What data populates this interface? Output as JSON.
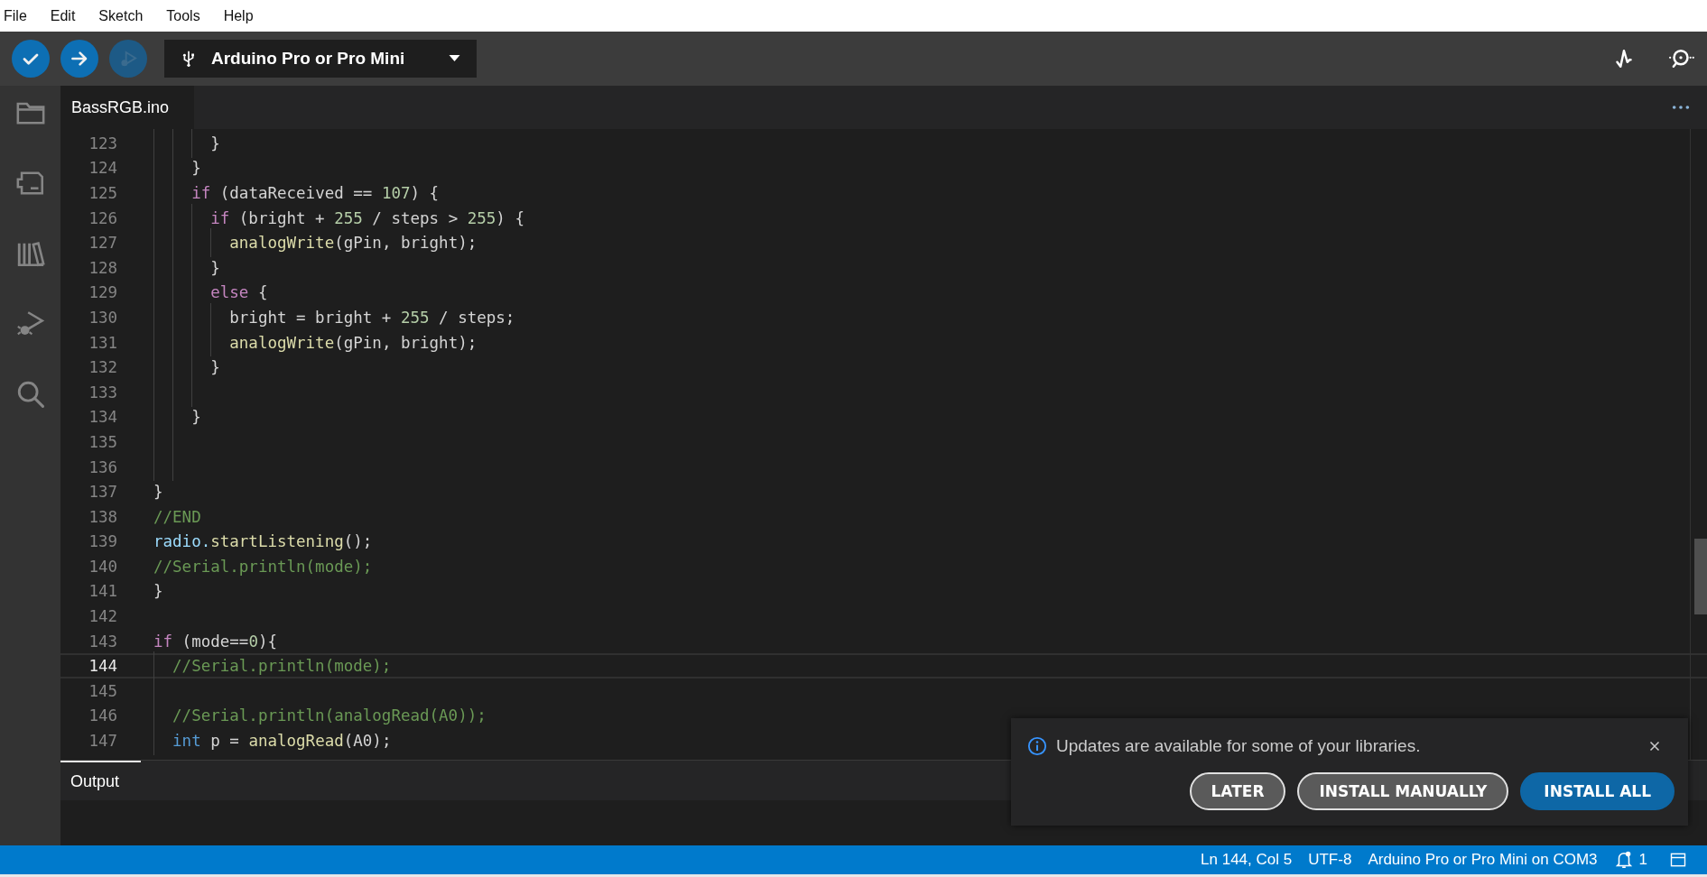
{
  "menu_bar": [
    "File",
    "Edit",
    "Sketch",
    "Tools",
    "Help"
  ],
  "toolbar": {
    "buttons": [
      {
        "kind": "verify",
        "disabled": false
      },
      {
        "kind": "upload",
        "disabled": false
      },
      {
        "kind": "debug",
        "disabled": true
      }
    ],
    "board_selector": {
      "label": "Arduino Pro or Pro Mini"
    },
    "right_buttons": [
      {
        "kind": "plotter"
      },
      {
        "kind": "monitor"
      }
    ]
  },
  "sidebar": {
    "items": [
      {
        "kind": "sketchbook"
      },
      {
        "kind": "boards"
      },
      {
        "kind": "libraries"
      },
      {
        "kind": "debug"
      },
      {
        "kind": "search"
      }
    ]
  },
  "tabs": [
    {
      "label": "BassRGB.ino",
      "selected": true
    }
  ],
  "editor": {
    "lines": [
      {
        "number": "123",
        "current": false,
        "tokens": [
          {
            "text": "      }",
            "kind": "plain"
          }
        ]
      },
      {
        "number": "124",
        "current": false,
        "tokens": [
          {
            "text": "    }",
            "kind": "plain"
          }
        ]
      },
      {
        "number": "125",
        "current": false,
        "tokens": [
          {
            "text": "    if",
            "kind": "keyword"
          },
          {
            "text": " (dataReceived == ",
            "kind": "plain"
          },
          {
            "text": "107",
            "kind": "number"
          },
          {
            "text": ") {",
            "kind": "plain"
          }
        ]
      },
      {
        "number": "126",
        "current": false,
        "tokens": [
          {
            "text": "      if",
            "kind": "keyword"
          },
          {
            "text": " (bright + ",
            "kind": "plain"
          },
          {
            "text": "255",
            "kind": "number"
          },
          {
            "text": " / steps > ",
            "kind": "plain"
          },
          {
            "text": "255",
            "kind": "number"
          },
          {
            "text": ") {",
            "kind": "plain"
          }
        ]
      },
      {
        "number": "127",
        "current": false,
        "tokens": [
          {
            "text": "        analogWrite",
            "kind": "function"
          },
          {
            "text": "(gPin, bright);",
            "kind": "plain"
          }
        ]
      },
      {
        "number": "128",
        "current": false,
        "tokens": [
          {
            "text": "      }",
            "kind": "plain"
          }
        ]
      },
      {
        "number": "129",
        "current": false,
        "tokens": [
          {
            "text": "      else",
            "kind": "keyword"
          },
          {
            "text": " {",
            "kind": "plain"
          }
        ]
      },
      {
        "number": "130",
        "current": false,
        "tokens": [
          {
            "text": "        bright = bright + ",
            "kind": "plain"
          },
          {
            "text": "255",
            "kind": "number"
          },
          {
            "text": " / steps;",
            "kind": "plain"
          }
        ]
      },
      {
        "number": "131",
        "current": false,
        "tokens": [
          {
            "text": "        analogWrite",
            "kind": "function"
          },
          {
            "text": "(gPin, bright);",
            "kind": "plain"
          }
        ]
      },
      {
        "number": "132",
        "current": false,
        "tokens": [
          {
            "text": "      }",
            "kind": "plain"
          }
        ]
      },
      {
        "number": "133",
        "current": false
      },
      {
        "number": "134",
        "current": false,
        "tokens": [
          {
            "text": "    }",
            "kind": "plain"
          }
        ]
      },
      {
        "number": "135",
        "current": false
      },
      {
        "number": "136",
        "current": false
      },
      {
        "number": "137",
        "current": false,
        "tokens": [
          {
            "text": "}",
            "kind": "plain"
          }
        ]
      },
      {
        "number": "138",
        "current": false,
        "tokens": [
          {
            "text": "//END",
            "kind": "comment"
          }
        ]
      },
      {
        "number": "139",
        "current": false,
        "tokens": [
          {
            "text": "radio.",
            "kind": "variable"
          },
          {
            "text": "startListening",
            "kind": "function"
          },
          {
            "text": "();",
            "kind": "plain"
          }
        ]
      },
      {
        "number": "140",
        "current": false,
        "tokens": [
          {
            "text": "//Serial.println(mode);",
            "kind": "comment"
          }
        ]
      },
      {
        "number": "141",
        "current": false,
        "tokens": [
          {
            "text": "}",
            "kind": "plain"
          }
        ]
      },
      {
        "number": "142",
        "current": false
      },
      {
        "number": "143",
        "current": false,
        "tokens": [
          {
            "text": "if",
            "kind": "keyword"
          },
          {
            "text": " (mode==",
            "kind": "plain"
          },
          {
            "text": "0",
            "kind": "number"
          },
          {
            "text": "){",
            "kind": "plain"
          }
        ]
      },
      {
        "number": "144",
        "current": true,
        "tokens": [
          {
            "text": "  //Serial.println(mode);",
            "kind": "comment"
          }
        ]
      },
      {
        "number": "145",
        "current": false
      },
      {
        "number": "146",
        "current": false,
        "tokens": [
          {
            "text": "  //Serial.println(analogRead(A0));",
            "kind": "comment"
          }
        ]
      },
      {
        "number": "147",
        "current": false,
        "tokens": [
          {
            "text": "  int",
            "kind": "type"
          },
          {
            "text": " p = ",
            "kind": "plain"
          },
          {
            "text": "analogRead",
            "kind": "function"
          },
          {
            "text": "(A0);",
            "kind": "plain"
          }
        ]
      }
    ]
  },
  "output_panel": {
    "tabs": [
      {
        "label": "Output",
        "selected": true
      }
    ]
  },
  "notification": {
    "message": "Updates are available for some of your libraries.",
    "buttons": [
      {
        "label": "LATER",
        "kind": "secondary"
      },
      {
        "label": "INSTALL MANUALLY",
        "kind": "secondary"
      },
      {
        "label": "INSTALL ALL",
        "kind": "primary"
      }
    ]
  },
  "status_bar": {
    "items": [
      "Ln 144, Col 5",
      "UTF-8",
      "Arduino Pro or Pro Mini on COM3"
    ],
    "notification_count": "1"
  }
}
